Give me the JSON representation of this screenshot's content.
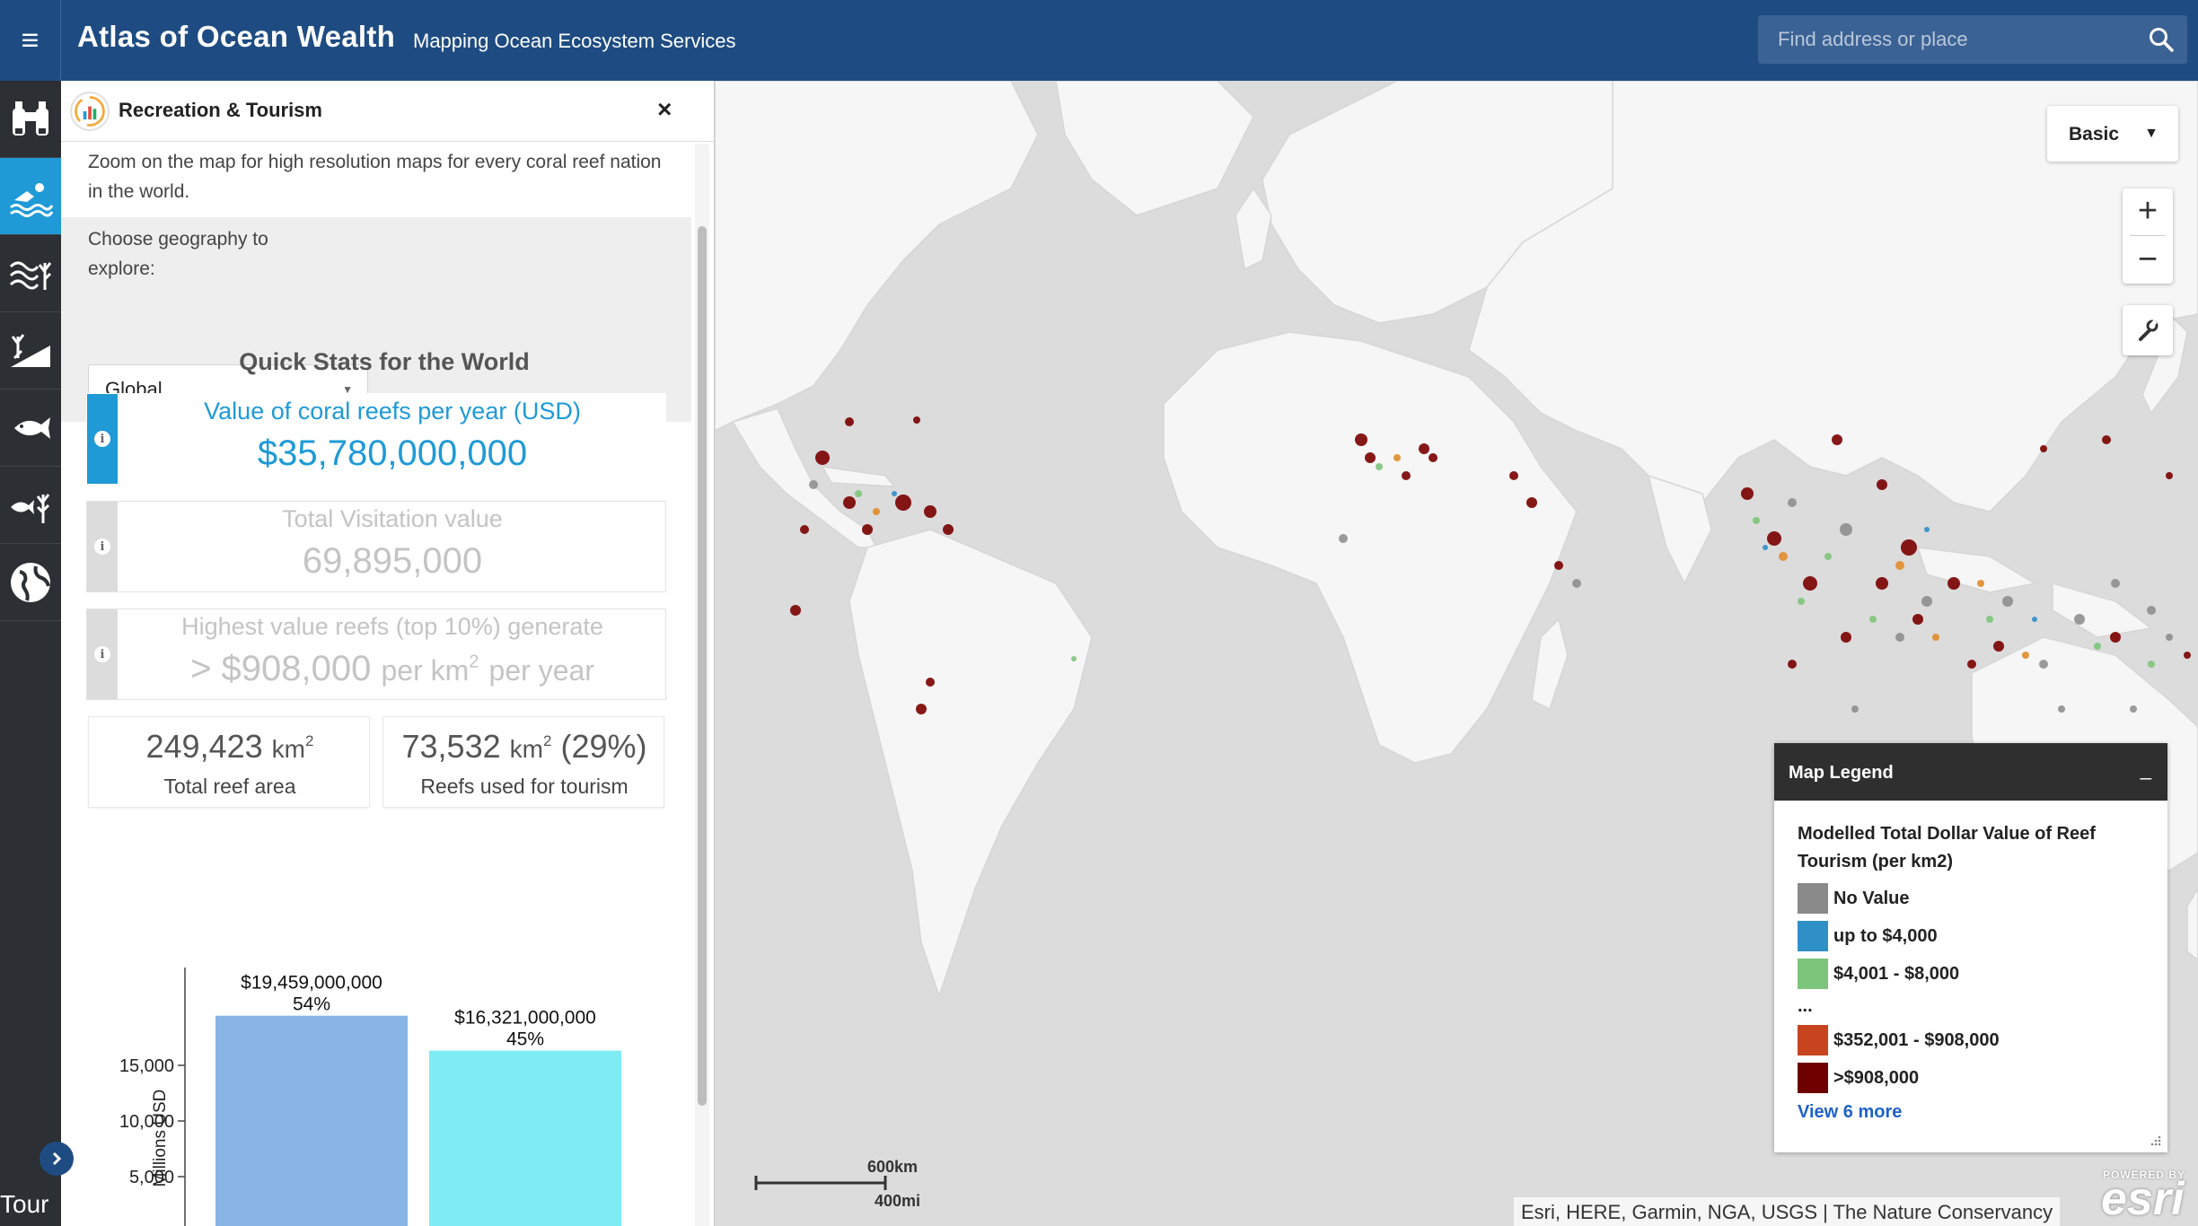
{
  "header": {
    "title": "Atlas of Ocean Wealth",
    "subtitle": "Mapping Ocean Ecosystem Services",
    "search_placeholder": "Find address or place",
    "menu_icon": "hamburger-menu-icon",
    "search_icon": "search-icon"
  },
  "rail": {
    "items": [
      {
        "name": "binoculars-icon",
        "active": false
      },
      {
        "name": "recreation-swimmer-icon",
        "active": true
      },
      {
        "name": "coastal-protection-waves-icon",
        "active": false
      },
      {
        "name": "mangrove-icon",
        "active": false
      },
      {
        "name": "fish-icon",
        "active": false
      },
      {
        "name": "fish-coral-icon",
        "active": false
      },
      {
        "name": "globe-icon",
        "active": false
      }
    ],
    "tour_label": "Tour"
  },
  "panel": {
    "title": "Recreation & Tourism",
    "close": "×",
    "intro": "Zoom on the map for high resolution maps for every coral reef nation in the world.",
    "geo_label": "Choose geography to explore:",
    "geo_value": "Global",
    "stats_title": "Quick Stats for the World",
    "stats": {
      "coral_label": "Value of coral reefs per year (USD)",
      "coral_value": "$35,780,000,000",
      "visit_label": "Total Visitation value",
      "visit_value": "69,895,000",
      "high_label": "Highest value reefs (top 10%) generate",
      "high_value": "> $908,000",
      "high_unit_pre": "per km",
      "high_unit_sup": "2",
      "high_unit_post": "per year",
      "reef_area_value": "249,423",
      "reef_area_unit": "km",
      "reef_area_sup": "2",
      "reef_area_label": "Total reef area",
      "tourism_value": "73,532",
      "tourism_unit": "km",
      "tourism_sup": "2",
      "tourism_pct": "(29%)",
      "tourism_label": "Reefs used for tourism"
    },
    "colors": {
      "accent": "#1f9ad6",
      "inactive_tab": "#dcdcdc"
    }
  },
  "chart_data": {
    "type": "bar",
    "categories": [
      "",
      ""
    ],
    "values": [
      19459,
      16321
    ],
    "data_labels": [
      "$19,459,000,000",
      "$16,321,000,000"
    ],
    "pct_labels": [
      "54%",
      "45%"
    ],
    "colors": [
      "#89b4e6",
      "#7eedf3"
    ],
    "title": "",
    "xlabel": "",
    "ylabel": "Millions USD",
    "yticks": [
      5000,
      10000,
      15000
    ],
    "ytick_labels": [
      "5,000",
      "10,000",
      "15,000"
    ],
    "ylim": [
      0,
      22000
    ],
    "grid": false
  },
  "map": {
    "basemap_label": "Basic",
    "zoom_in": "+",
    "zoom_out": "−",
    "tool_icon": "wrench-icon",
    "scale_km": "600km",
    "scale_mi": "400mi",
    "attribution": "Esri, HERE, Garmin, NGA, USGS | The Nature Conservancy",
    "esri_powered": "POWERED BY",
    "esri_word": "esri"
  },
  "legend": {
    "title": "Map Legend",
    "minimize": "_",
    "layer_title": "Modelled Total Dollar Value of Reef Tourism (per km2)",
    "items": [
      {
        "label": "No Value",
        "color": "#8a8a8a"
      },
      {
        "label": "up to $4,000",
        "color": "#2f8fc7"
      },
      {
        "label": "$4,001 - $8,000",
        "color": "#7dc57a"
      },
      {
        "label": "$352,001 - $908,000",
        "color": "#c8441f"
      },
      {
        "label": ">$908,000",
        "color": "#6e0000"
      }
    ],
    "ellipsis": "...",
    "more": "View 6 more"
  }
}
